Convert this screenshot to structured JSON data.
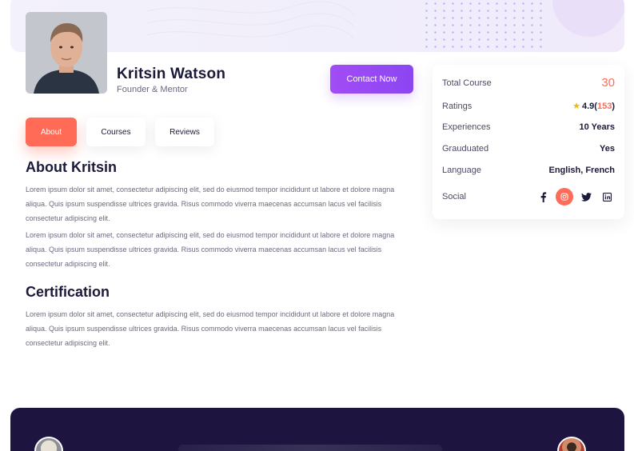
{
  "profile": {
    "name": "Kritsin Watson",
    "role": "Founder & Mentor",
    "contact_label": "Contact Now"
  },
  "tabs": [
    {
      "label": "About",
      "active": true
    },
    {
      "label": "Courses",
      "active": false
    },
    {
      "label": "Reviews",
      "active": false
    }
  ],
  "about": {
    "title": "About Kritsin",
    "paragraphs": [
      "Lorem ipsum dolor sit amet, consectetur adipiscing elit, sed do eiusmod tempor incididunt ut labore et dolore magna aliqua. Quis ipsum suspendisse ultrices gravida. Risus commodo viverra maecenas accumsan lacus vel facilisis consectetur adipiscing elit.",
      "Lorem ipsum dolor sit amet, consectetur adipiscing elit, sed do eiusmod tempor incididunt ut labore et dolore magna aliqua. Quis ipsum suspendisse ultrices gravida. Risus commodo viverra maecenas accumsan lacus vel facilisis consectetur adipiscing elit."
    ]
  },
  "certification": {
    "title": "Certification",
    "paragraph": "Lorem ipsum dolor sit amet, consectetur adipiscing elit, sed do eiusmod tempor incididunt ut labore et dolore magna aliqua. Quis ipsum suspendisse ultrices gravida. Risus commodo viverra maecenas accumsan lacus vel facilisis consectetur adipiscing elit."
  },
  "info": {
    "total_course": {
      "label": "Total Course",
      "value": "30"
    },
    "ratings": {
      "label": "Ratings",
      "score": "4.9",
      "open": "(",
      "count": "153",
      "close": ")"
    },
    "experiences": {
      "label": "Experiences",
      "value": "10 Years"
    },
    "graduated": {
      "label": "Grauduated",
      "value": "Yes"
    },
    "language": {
      "label": "Language",
      "value": "English, French"
    },
    "social": {
      "label": "Social",
      "icons": [
        "facebook-icon",
        "instagram-icon",
        "twitter-icon",
        "linkedin-icon"
      ]
    }
  },
  "colors": {
    "accent": "#ff6b57",
    "brand_purple": "#9a4af4",
    "dark_navy": "#1d1540",
    "star": "#f5b800"
  }
}
